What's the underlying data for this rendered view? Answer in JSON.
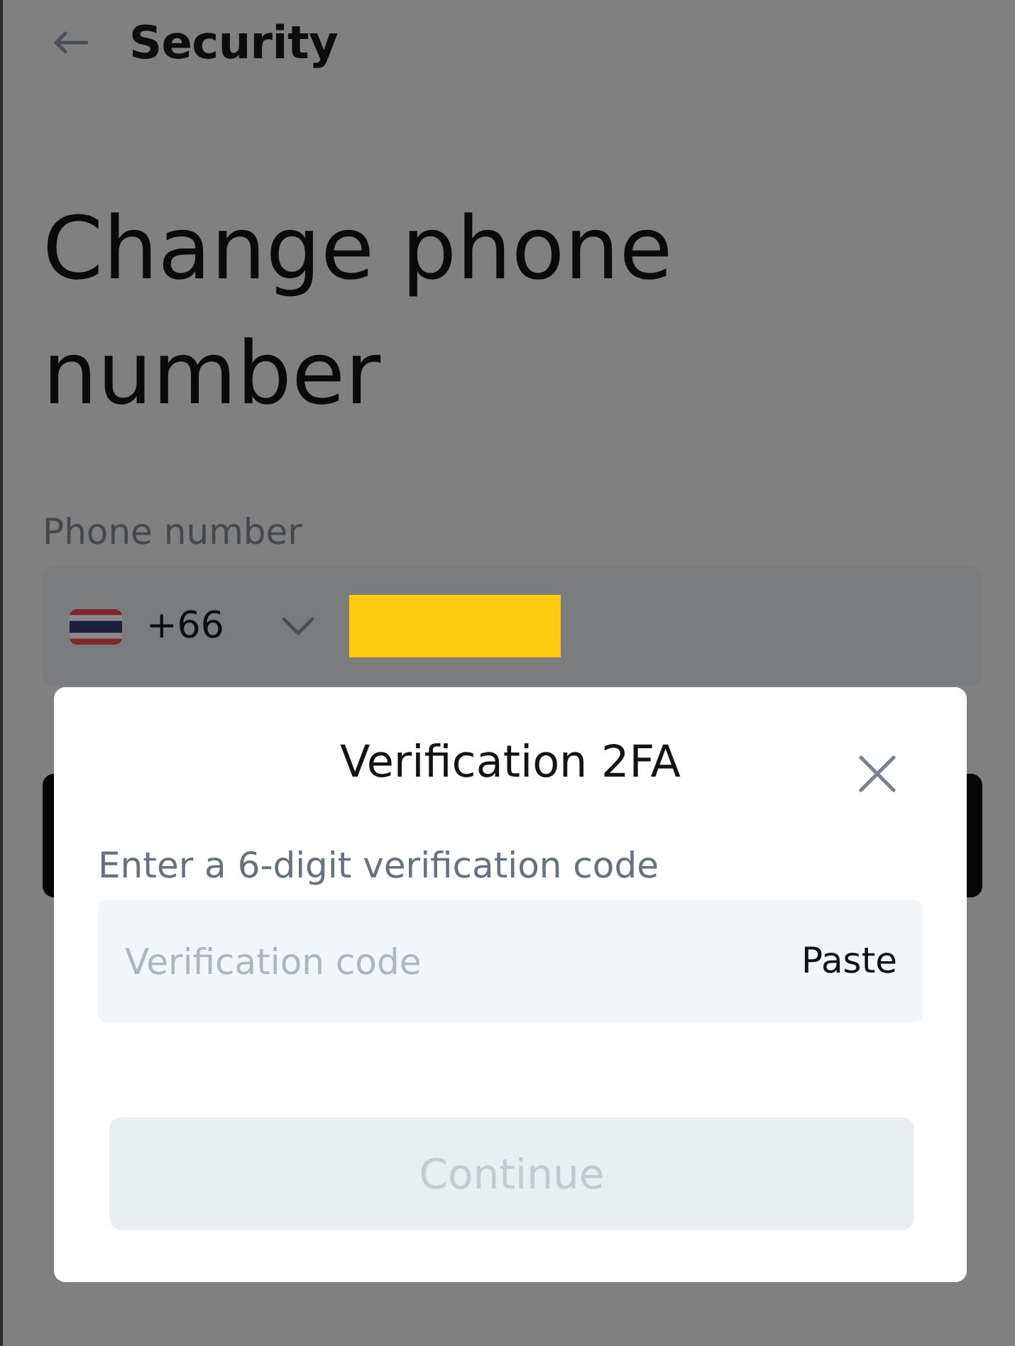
{
  "header": {
    "title": "Security"
  },
  "page": {
    "heading": "Change phone number",
    "phone_field": {
      "label": "Phone number",
      "country_code": "+66"
    }
  },
  "dialog": {
    "title": "Verification 2FA",
    "instruction": "Enter a 6-digit verification code",
    "code_field": {
      "placeholder": "Verification code",
      "action": "Paste"
    },
    "continue_button": {
      "label": "Continue",
      "disabled": true
    }
  }
}
